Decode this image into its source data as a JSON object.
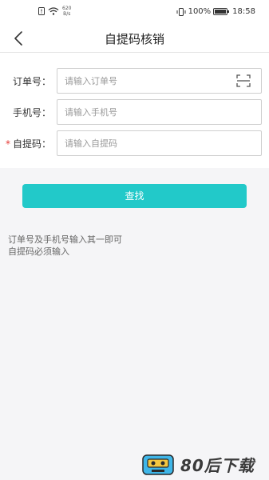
{
  "status_bar": {
    "net_speed_value": "620",
    "net_speed_unit": "B/s",
    "battery_percent": "100%",
    "time": "18:58"
  },
  "nav": {
    "title": "自提码核销"
  },
  "form": {
    "order": {
      "label": "订单号：",
      "placeholder": "请输入订单号"
    },
    "phone": {
      "label": "手机号：",
      "placeholder": "请输入手机号"
    },
    "pickup": {
      "required_mark": "*",
      "label": "自提码：",
      "placeholder": "请输入自提码"
    }
  },
  "search_button": {
    "label": "查找"
  },
  "hint": {
    "line1": "订单号及手机号输入其一即可",
    "line2": "自提码必须输入"
  },
  "watermark": {
    "text": "80后下载"
  },
  "colors": {
    "accent": "#22c9c9",
    "required": "#e53935"
  }
}
